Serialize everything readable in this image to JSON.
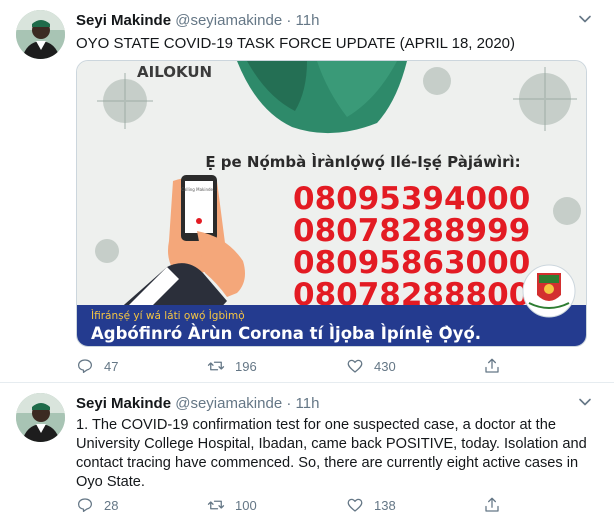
{
  "tweets": [
    {
      "author_name": "Seyi Makinde",
      "handle": "@seyiamakinde",
      "separator": "·",
      "time": "11h",
      "text": "OYO STATE COVID-19 TASK FORCE UPDATE (APRIL 18, 2020)",
      "media": {
        "top_word": "AILOKUN",
        "heading": "Ẹ pe Nọ́mbà Ìrànlọ́wọ́ Ilé-Iṣẹ́ Pàjáwìrì:",
        "phone_screen_text": "Calling Makinde...",
        "numbers": [
          "08095394000",
          "08078288999",
          "08095863000",
          "08078288800"
        ],
        "banner_small": "Ìfiránṣẹ́ yí wá láti ọwọ́ Ìgbìmọ̀",
        "banner_large": "Agbófinró Àrùn Corona tí Ìjọba Ìpínlẹ̀ Ọ̀yọ́."
      },
      "replies": "47",
      "retweets": "196",
      "likes": "430"
    },
    {
      "author_name": "Seyi Makinde",
      "handle": "@seyiamakinde",
      "separator": "·",
      "time": "11h",
      "text": "1. The COVID-19 confirmation test for one suspected case, a doctor at the University College Hospital, Ibadan, came back POSITIVE, today. Isolation and contact tracing have commenced. So, there are currently eight active cases in Oyo State.",
      "replies": "28",
      "retweets": "100",
      "likes": "138"
    }
  ],
  "colors": {
    "text": "#14171a",
    "muted": "#657786",
    "divider": "#e6ecf0",
    "number_red": "#e31b23",
    "banner_blue": "#243b8f",
    "banner_text": "#ffffff",
    "banner_small": "#f5c542"
  },
  "icons": [
    "avatar",
    "chevron-down-icon",
    "reply-icon",
    "retweet-icon",
    "like-icon",
    "share-icon",
    "hand-phone-illustration",
    "oyo-state-crest-icon"
  ]
}
